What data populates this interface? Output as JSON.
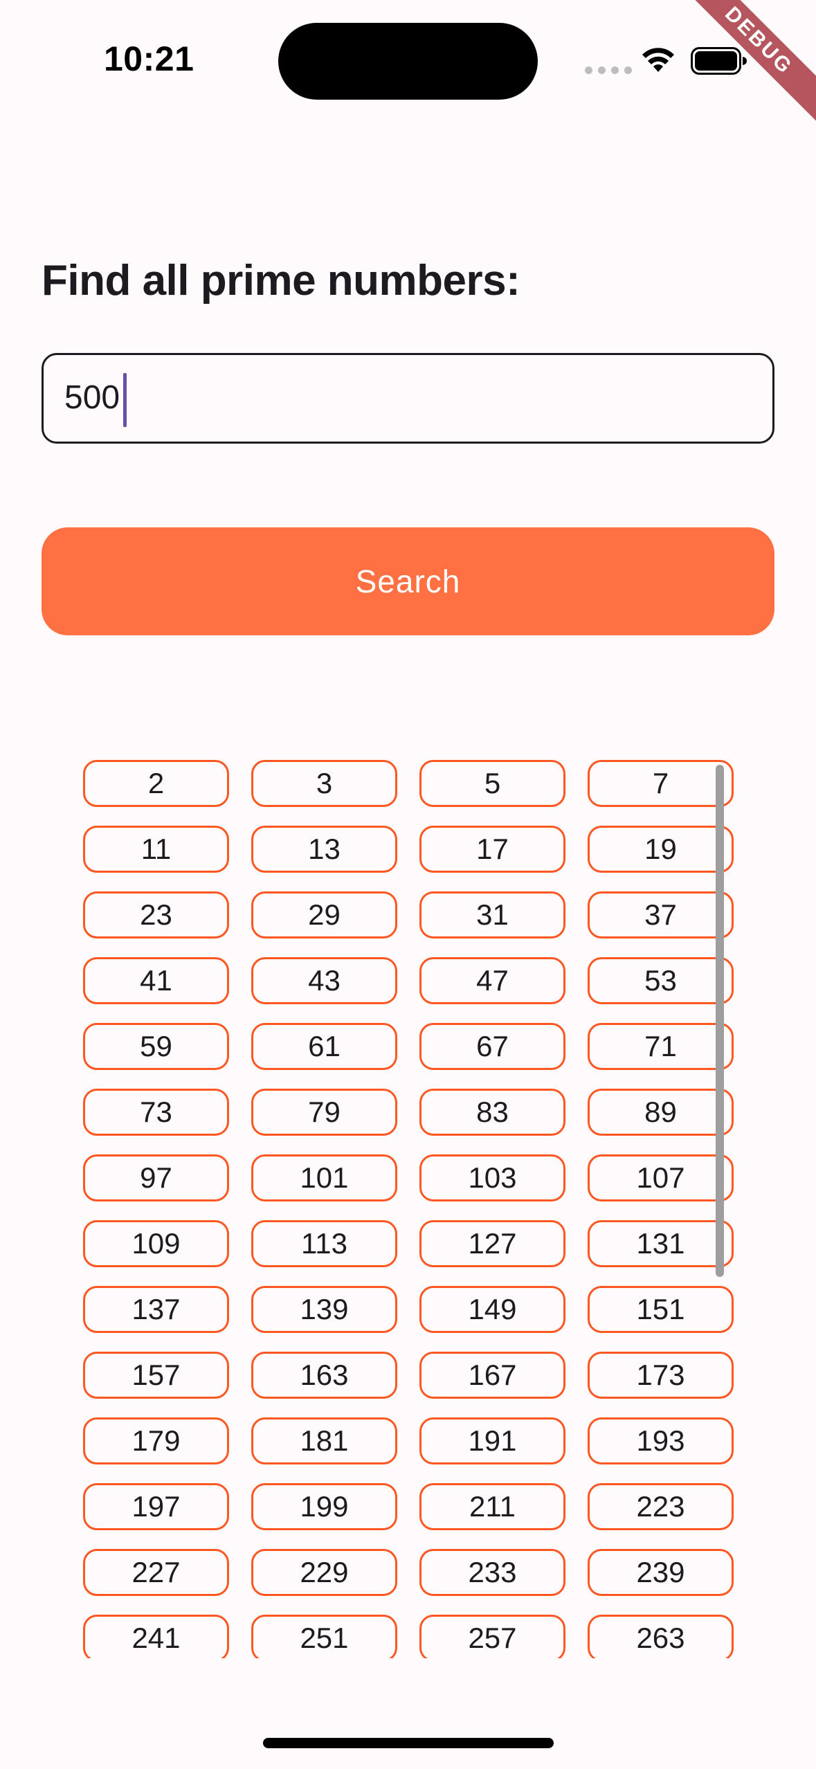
{
  "status_bar": {
    "time": "10:21",
    "icons": [
      "signal-icon",
      "wifi-icon",
      "battery-icon"
    ]
  },
  "debug_banner": "DEBUG",
  "page": {
    "title": "Find all prime numbers:",
    "input_value": "500",
    "search_label": "Search"
  },
  "colors": {
    "accent": "#FF7043",
    "chip_border": "#FF5722",
    "caret": "#6750A4",
    "background": "#FFFAFB"
  },
  "primes": [
    "2",
    "3",
    "5",
    "7",
    "11",
    "13",
    "17",
    "19",
    "23",
    "29",
    "31",
    "37",
    "41",
    "43",
    "47",
    "53",
    "59",
    "61",
    "67",
    "71",
    "73",
    "79",
    "83",
    "89",
    "97",
    "101",
    "103",
    "107",
    "109",
    "113",
    "127",
    "131",
    "137",
    "139",
    "149",
    "151",
    "157",
    "163",
    "167",
    "173",
    "179",
    "181",
    "191",
    "193",
    "197",
    "199",
    "211",
    "223",
    "227",
    "229",
    "233",
    "239",
    "241",
    "251",
    "257",
    "263"
  ]
}
